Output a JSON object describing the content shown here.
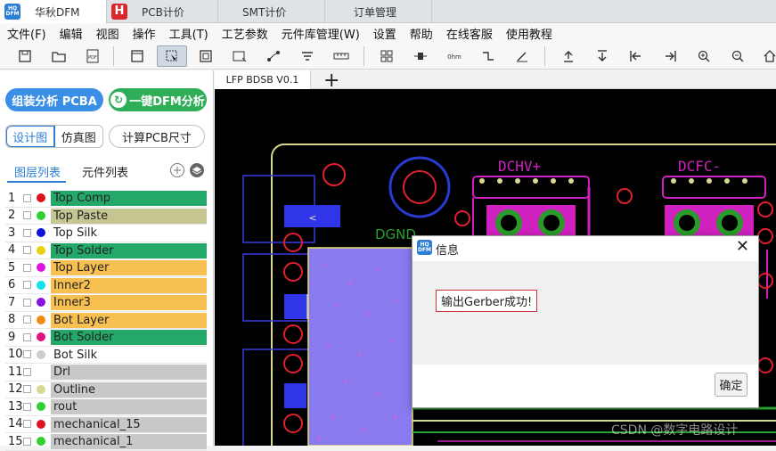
{
  "tabs": [
    {
      "label": "华秋DFM",
      "logo": "HQ DFM"
    },
    {
      "label": "PCB计价",
      "logo": "H"
    },
    {
      "label": "SMT计价"
    },
    {
      "label": "订单管理"
    }
  ],
  "menu": [
    "文件(F)",
    "编辑",
    "视图",
    "操作",
    "工具(T)",
    "工艺参数",
    "元件库管理(W)",
    "设置",
    "帮助",
    "在线客服",
    "使用教程"
  ],
  "toolbar": {
    "icons": [
      "save-icon",
      "open-folder-icon",
      "pdf-icon",
      "layout-icon",
      "select-icon",
      "zoom-box-icon",
      "move-icon",
      "route-icon",
      "stack-icon",
      "measure-icon",
      "grid-icon",
      "component-icon",
      "ohm-icon",
      "wire-icon",
      "probe-icon",
      "upload-icon",
      "download-icon",
      "align-left-icon",
      "align-right-icon",
      "zoom-in-icon",
      "zoom-out-icon",
      "home-icon"
    ],
    "pdf_label": "PDF",
    "ohm_label": "0hm"
  },
  "left": {
    "assembly_button": "组装分析 PCBA",
    "dfm_button": "一键DFM分析",
    "design_view": "设计图",
    "sim_view": "仿真图",
    "calc_size": "计算PCB尺寸",
    "layers_tab": "图层列表",
    "components_tab": "元件列表"
  },
  "layers": [
    {
      "num": "1",
      "name": "Top Comp",
      "dot": "#e0101a",
      "bg": "#24a86a"
    },
    {
      "num": "2",
      "name": "Top Paste",
      "dot": "#2fd02f",
      "bg": "#c5c592"
    },
    {
      "num": "3",
      "name": "Top Silk",
      "dot": "#1010d8",
      "bg": "#ffffff"
    },
    {
      "num": "4",
      "name": "Top Solder",
      "dot": "#e8d010",
      "bg": "#24a86a"
    },
    {
      "num": "5",
      "name": "Top Layer",
      "dot": "#e010e0",
      "bg": "#f8c050"
    },
    {
      "num": "6",
      "name": "Inner2",
      "dot": "#10e0f0",
      "bg": "#f8c050"
    },
    {
      "num": "7",
      "name": "Inner3",
      "dot": "#8a10e0",
      "bg": "#f8c050"
    },
    {
      "num": "8",
      "name": "Bot Layer",
      "dot": "#f08a10",
      "bg": "#f8c050"
    },
    {
      "num": "9",
      "name": "Bot Solder",
      "dot": "#e01080",
      "bg": "#24a86a"
    },
    {
      "num": "10",
      "name": "Bot Silk",
      "dot": "#cccccc",
      "bg": "#ffffff"
    },
    {
      "num": "11",
      "name": "Drl",
      "dot": "",
      "bg": "#c8c8c8"
    },
    {
      "num": "12",
      "name": "Outline",
      "dot": "#d8d890",
      "bg": "#c8c8c8"
    },
    {
      "num": "13",
      "name": "rout",
      "dot": "#2fd02f",
      "bg": "#c8c8c8"
    },
    {
      "num": "14",
      "name": "mechanical_15",
      "dot": "#e01020",
      "bg": "#c8c8c8"
    },
    {
      "num": "15",
      "name": "mechanical_1",
      "dot": "#2fd02f",
      "bg": "#c8c8c8"
    }
  ],
  "canvas": {
    "tab_label": "LFP BDSB V0.1",
    "plus": "+",
    "labels": {
      "dchv": "DCHV+",
      "dcfc": "DCFC-",
      "dgnd": "DGND",
      "arrow": "<"
    }
  },
  "dialog": {
    "title": "信息",
    "message": "输出Gerber成功!",
    "ok": "确定",
    "close": "✕",
    "logo": "HQ DFM"
  },
  "watermark": "CSDN @数字电路设计"
}
